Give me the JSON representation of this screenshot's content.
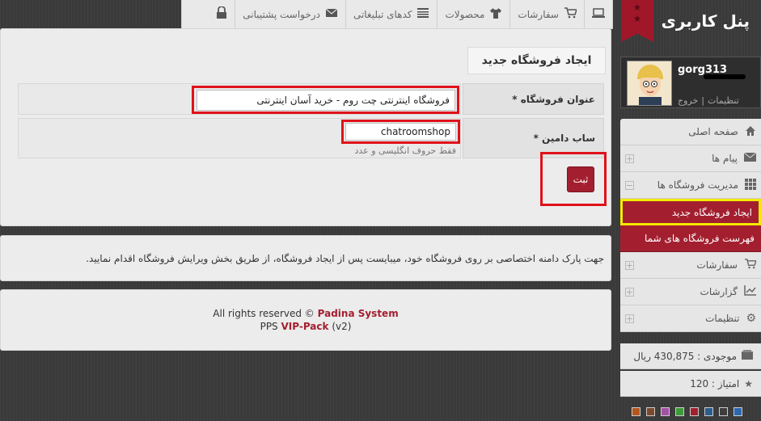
{
  "tabs": [
    {
      "label": "",
      "icon": "laptop-icon"
    },
    {
      "label": "سفارشات",
      "icon": "cart-icon"
    },
    {
      "label": "محصولات",
      "icon": "shirt-icon"
    },
    {
      "label": "کدهای تبلیغاتی",
      "icon": "barcode-icon"
    },
    {
      "label": "درخواست پشتیبانی",
      "icon": "mail-icon"
    },
    {
      "label": "",
      "icon": "lock-icon"
    }
  ],
  "page": {
    "title": "ایجاد فروشگاه جدید"
  },
  "form": {
    "shop_title_label": "عنوان فروشگاه *",
    "shop_title_value": "فروشگاه اینترنتی چت روم - خرید آسان اینترنتی",
    "subdomain_label": "ساب دامین *",
    "subdomain_value": "chatroomshop",
    "subdomain_hint": "فقط حروف انگلیسی و عدد",
    "submit_label": "ثبت"
  },
  "info": {
    "text": "جهت پارک دامنه اختصاصی بر روی فروشگاه خود، میبایست پس از ایجاد فروشگاه، از طریق بخش ویرایش فروشگاه اقدام نمایید."
  },
  "footer": {
    "rights": "All rights reserved ©",
    "brand": "Padina System",
    "pps": "PPS",
    "vip": "VIP-Pack",
    "version": "(v2)"
  },
  "sidebar": {
    "title": "پنل کاربری",
    "username": "gorg313",
    "logout": "خروج",
    "settings": "تنظیمات",
    "menu": [
      {
        "label": "صفحه اصلی",
        "icon": "home-icon"
      },
      {
        "label": "پیام ها",
        "icon": "mail-icon"
      },
      {
        "label": "مدیریت فروشگاه ها",
        "icon": "grid-icon"
      }
    ],
    "submenu": [
      {
        "label": "ایجاد فروشگاه جدید"
      },
      {
        "label": "فهرست فروشگاه های شما"
      }
    ],
    "menu2": [
      {
        "label": "سفارشات",
        "icon": "cart-icon"
      },
      {
        "label": "گزارشات",
        "icon": "chart-icon"
      },
      {
        "label": "تنظیمات",
        "icon": "gear-icon"
      }
    ],
    "balance": "موجودی : 430,875 ریال",
    "score": "امتیاز : 120"
  },
  "colors": {
    "accent": "#a31f2f",
    "highlight_red": "#e0121a",
    "highlight_yellow": "#f4ea00",
    "swatches": [
      "#b5561d",
      "#7c4a2a",
      "#a352a6",
      "#3d9a3a",
      "#a31f2f",
      "#2c5c8c",
      "#3e3e3e",
      "#2a68b0"
    ]
  }
}
